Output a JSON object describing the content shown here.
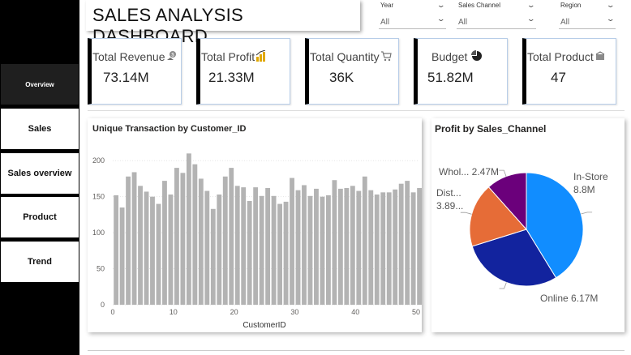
{
  "dashboard_title": "SALES ANALYSIS DASHBOARD",
  "nav": [
    {
      "label": "Overview"
    },
    {
      "label": "Sales"
    },
    {
      "label": "Sales overview"
    },
    {
      "label": "Product"
    },
    {
      "label": "Trend"
    }
  ],
  "slicers": [
    {
      "label": "Year",
      "value": "All"
    },
    {
      "label": "Sales Channel",
      "value": "All"
    },
    {
      "label": "Region",
      "value": "All"
    }
  ],
  "kpis": [
    {
      "label": "Total Revenue",
      "value": "73.14M",
      "icon": "money-bag-icon"
    },
    {
      "label": "Total Profit",
      "value": "21.33M",
      "icon": "profit-chart-icon"
    },
    {
      "label": "Total Quantity",
      "value": "36K",
      "icon": "cart-icon"
    },
    {
      "label": "Budget",
      "value": "51.82M",
      "icon": "pie-icon"
    },
    {
      "label": "Total Product",
      "value": "47",
      "icon": "box-icon"
    }
  ],
  "colors": {
    "bar": "#b3b3b3",
    "kpi_border": "#b7cde8",
    "in_store": "#118dff",
    "online": "#12239e",
    "distributor": "#e66c37",
    "wholesale": "#6b007b"
  },
  "chart_data": [
    {
      "type": "bar",
      "title": "Unique Transaction by Customer_ID",
      "xlabel": "CustomerID",
      "ylabel": "",
      "x": [
        1,
        2,
        3,
        4,
        5,
        6,
        7,
        8,
        9,
        10,
        11,
        12,
        13,
        14,
        15,
        16,
        17,
        18,
        19,
        20,
        21,
        22,
        23,
        24,
        25,
        26,
        27,
        28,
        29,
        30,
        31,
        32,
        33,
        34,
        35,
        36,
        37,
        38,
        39,
        40,
        41,
        42,
        43,
        44,
        45,
        46,
        47,
        48,
        49,
        50
      ],
      "values": [
        152,
        135,
        178,
        184,
        165,
        157,
        150,
        140,
        172,
        153,
        190,
        183,
        210,
        195,
        175,
        158,
        133,
        153,
        178,
        190,
        165,
        163,
        144,
        163,
        151,
        162,
        151,
        140,
        143,
        176,
        159,
        166,
        151,
        161,
        150,
        152,
        173,
        161,
        162,
        165,
        158,
        178,
        159,
        153,
        156,
        156,
        160,
        168,
        172,
        156,
        162
      ],
      "x_ticks": [
        0,
        10,
        20,
        30,
        40,
        50
      ],
      "y_ticks": [
        0,
        50,
        100,
        150,
        200
      ],
      "ylim": [
        0,
        225
      ],
      "xlim": [
        0,
        50
      ],
      "grid": true
    },
    {
      "type": "pie",
      "title": "Profit by Sales_Channel",
      "slices": [
        {
          "name": "In-Store",
          "label": "8.8M",
          "value": 8.8
        },
        {
          "name": "Online",
          "label": "6.17M",
          "value": 6.17
        },
        {
          "name": "Dist...",
          "label": "3.89...",
          "value": 3.89
        },
        {
          "name": "Whol...",
          "label": "2.47M",
          "value": 2.47
        }
      ]
    }
  ]
}
